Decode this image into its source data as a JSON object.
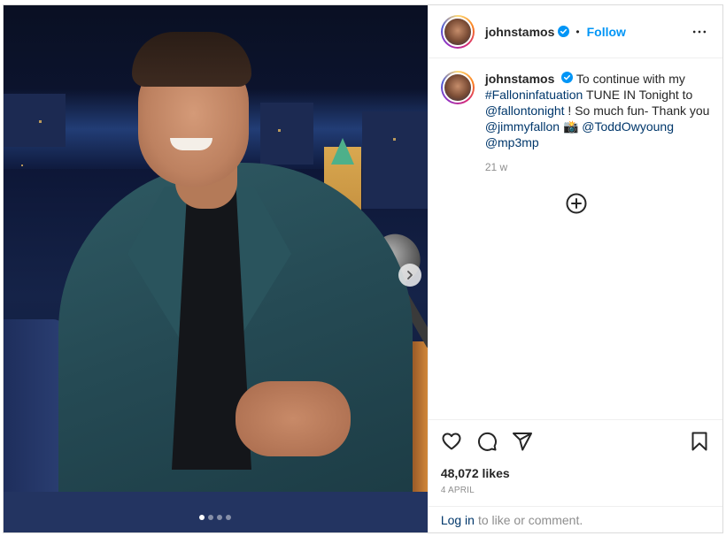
{
  "post": {
    "username": "johnstamos",
    "follow_label": "Follow",
    "separator": "•",
    "caption": {
      "text_1": "To continue with my",
      "hashtag": "#Falloninfatuation",
      "text_2": "TUNE IN Tonight to",
      "mention_1": "@fallontonight",
      "text_3": "! So much fun- Thank you",
      "mention_2": "@jimmyfallon",
      "emoji": "📸",
      "mention_3": "@ToddOwyoung",
      "mention_4": "@mp3mp"
    },
    "time_ago": "21 w",
    "likes": "48,072 likes",
    "date": "4 APRIL",
    "carousel": {
      "count": 4,
      "active": 0
    },
    "login": {
      "link": "Log in",
      "rest": "to like or comment."
    },
    "colors": {
      "follow": "#0095f6",
      "link": "#00376b",
      "muted": "#8e8e8e",
      "verified": "#0095f6"
    },
    "icons": [
      "verified-badge-icon",
      "more-options-icon",
      "add-comment-icon",
      "heart-icon",
      "comment-icon",
      "share-icon",
      "bookmark-icon",
      "chevron-right-icon"
    ]
  }
}
